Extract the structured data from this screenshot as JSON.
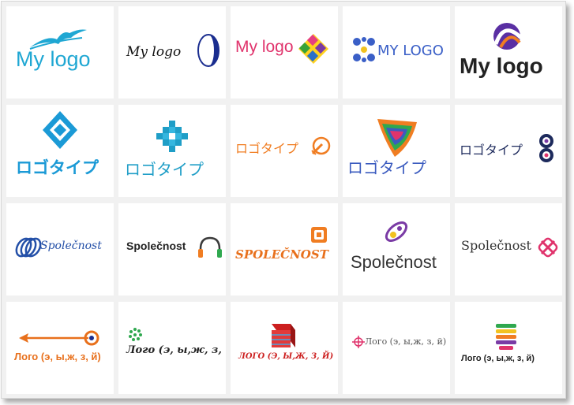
{
  "gallery": {
    "rows": [
      {
        "tiles": [
          {
            "text": "My logo",
            "color": "#1fa7d3",
            "icon": "swoosh-icon"
          },
          {
            "text": "My logo",
            "color": "#111111",
            "icon": "half-moon-icon"
          },
          {
            "text": "My logo",
            "color": "#e0336c",
            "icon": "diamond-squares-icon"
          },
          {
            "text": "MY LOGO",
            "color": "#3a5fc7",
            "icon": "dots-cross-icon"
          },
          {
            "text": "My logo",
            "color": "#222222",
            "icon": "orbit-circle-icon"
          }
        ]
      },
      {
        "tiles": [
          {
            "text": "ロゴタイプ",
            "color": "#1b9ad6",
            "icon": "double-diamond-icon"
          },
          {
            "text": "ロゴタイプ",
            "color": "#1f9ec7",
            "icon": "pixel-cross-icon"
          },
          {
            "text": "ロゴタイプ",
            "color": "#f07d22",
            "icon": "target-arrow-icon"
          },
          {
            "text": "ロゴタイプ",
            "color": "#3b5bbf",
            "icon": "rainbow-shield-icon"
          },
          {
            "text": "ロゴタイプ",
            "color": "#1d2a5c",
            "icon": "figure-eight-icon"
          }
        ]
      },
      {
        "tiles": [
          {
            "text": "Společnost",
            "color": "#2450a8",
            "icon": "rings-icon"
          },
          {
            "text": "Společnost",
            "color": "#222222",
            "icon": "headphones-icon"
          },
          {
            "text": "SPOLEČNOST",
            "color": "#e8701c",
            "icon": "square-badge-icon"
          },
          {
            "text": "Společnost",
            "color": "#333333",
            "icon": "orbit-sphere-icon"
          },
          {
            "text": "Společnost",
            "color": "#333333",
            "icon": "knot-icon"
          }
        ]
      },
      {
        "tiles": [
          {
            "text": "Лого (э, ы,ж, з, й)",
            "color": "#e8701c",
            "icon": "arrow-target-icon"
          },
          {
            "text": "Лого (э, ы,ж, з, й)",
            "color": "#222222",
            "icon": "dot-swirl-icon"
          },
          {
            "text": "ЛОГО (Э, Ы,Ж, З, Й)",
            "color": "#cc1f1f",
            "icon": "cube-icon"
          },
          {
            "text": "Лого (э, ы,ж, з, й)",
            "color": "#555555",
            "icon": "crosshair-icon"
          },
          {
            "text": "Лого (э, ы,ж, з, й)",
            "color": "#222222",
            "icon": "stacked-bars-icon"
          }
        ]
      }
    ]
  }
}
